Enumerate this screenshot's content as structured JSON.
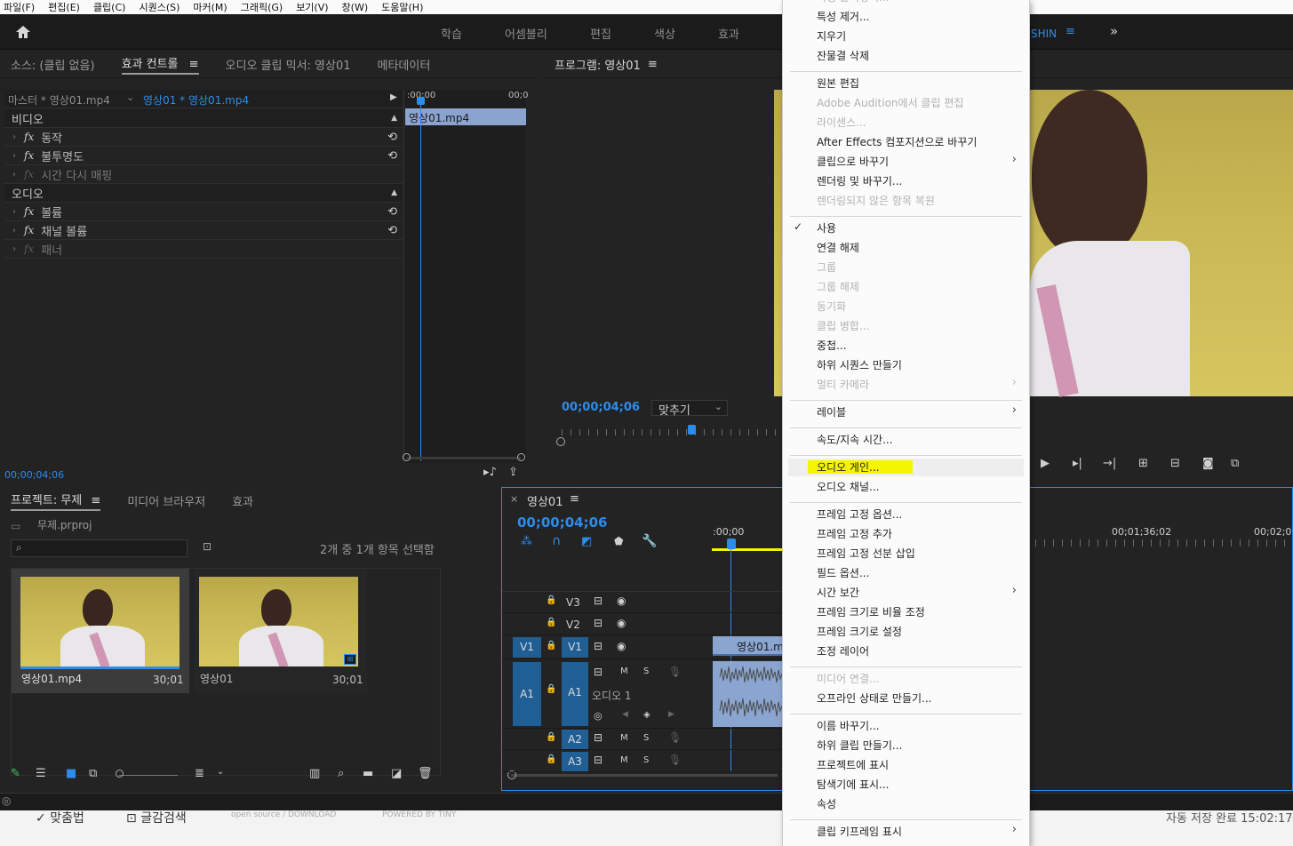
{
  "menubar": [
    "파일(F)",
    "편집(E)",
    "클립(C)",
    "시퀀스(S)",
    "마커(M)",
    "그래픽(G)",
    "보기(V)",
    "창(W)",
    "도움말(H)"
  ],
  "workspaces": [
    "학습",
    "어셈블리",
    "편집",
    "색상",
    "효과"
  ],
  "user_fragment": "SHIN",
  "icons": {
    "home": "home-icon",
    "more": "double-chevron-right-icon"
  },
  "source_panel": {
    "tabs": [
      "소스: (클립 없음)",
      "효과 컨트롤",
      "오디오 클립 믹서: 영상01",
      "메타데이터"
    ],
    "active_tab": "효과 컨트롤",
    "master_label": "마스터 * 영상01.mp4",
    "sequence_label": "영상01 * 영상01.mp4",
    "ruler_start": ":00;00",
    "ruler_end": "00;0",
    "clip_name": "영상01.mp4",
    "sections": [
      {
        "title": "비디오",
        "effects": [
          {
            "name": "동작",
            "enabled": true
          },
          {
            "name": "불투명도",
            "enabled": true
          },
          {
            "name": "시간 다시 매핑",
            "enabled": false
          }
        ]
      },
      {
        "title": "오디오",
        "effects": [
          {
            "name": "볼륨",
            "enabled": true
          },
          {
            "name": "채널 볼륨",
            "enabled": true
          },
          {
            "name": "패너",
            "enabled": false
          }
        ]
      }
    ],
    "timecode": "00;00;04;06"
  },
  "program_monitor": {
    "title": "프로그램: 영상01",
    "timecode": "00;00;04;06",
    "fit": "맞추기"
  },
  "project_panel": {
    "tabs": [
      "프로젝트: 무제",
      "미디어 브라우저",
      "효과"
    ],
    "project_file": "무제.prproj",
    "search_placeholder": "",
    "selection_status": "2개 중 1개 항목 선택함",
    "items": [
      {
        "name": "영상01.mp4",
        "duration": "30;01",
        "selected": true
      },
      {
        "name": "영상01",
        "duration": "30;01",
        "selected": false
      }
    ]
  },
  "timeline": {
    "title": "영상01",
    "timecode": "00;00;04;06",
    "ruler": [
      ":00;00",
      "00;01;36;02",
      "00;02;0"
    ],
    "tracks": {
      "video": [
        {
          "name": "V3"
        },
        {
          "name": "V2"
        },
        {
          "name": "V1",
          "source": "V1",
          "clip": "영상01.m"
        }
      ],
      "audio": [
        {
          "name": "A1",
          "source": "A1",
          "label": "오디오 1"
        },
        {
          "name": "A2"
        },
        {
          "name": "A3"
        }
      ]
    },
    "track_buttons": {
      "mute": "M",
      "solo": "S"
    }
  },
  "context_menu": {
    "items": [
      {
        "label": "속성 붙여넣기...",
        "disabled": true,
        "partial": true
      },
      {
        "label": "특성 제거...",
        "disabled": false
      },
      {
        "label": "지우기",
        "disabled": false
      },
      {
        "label": "잔물결 삭제",
        "disabled": false
      },
      {
        "sep": true
      },
      {
        "label": "원본 편집",
        "disabled": false
      },
      {
        "label": "Adobe Audition에서 클립 편집",
        "disabled": true
      },
      {
        "label": "라이센스...",
        "disabled": true
      },
      {
        "label": "After Effects 컴포지션으로 바꾸기",
        "disabled": false
      },
      {
        "label": "클립으로 바꾸기",
        "disabled": false,
        "submenu": true
      },
      {
        "label": "렌더링 및 바꾸기...",
        "disabled": false
      },
      {
        "label": "렌더링되지 않은 항목 복원",
        "disabled": true
      },
      {
        "sep": true
      },
      {
        "label": "사용",
        "disabled": false,
        "checked": true
      },
      {
        "label": "연결 해제",
        "disabled": false
      },
      {
        "label": "그룹",
        "disabled": true
      },
      {
        "label": "그룹 해제",
        "disabled": true
      },
      {
        "label": "동기화",
        "disabled": true
      },
      {
        "label": "클립 병합...",
        "disabled": true
      },
      {
        "label": "중첩...",
        "disabled": false
      },
      {
        "label": "하위 시퀀스 만들기",
        "disabled": false
      },
      {
        "label": "멀티 카메라",
        "disabled": true,
        "submenu": true
      },
      {
        "sep": true
      },
      {
        "label": "레이블",
        "disabled": false,
        "submenu": true
      },
      {
        "sep": true
      },
      {
        "label": "속도/지속 시간...",
        "disabled": false
      },
      {
        "sep": true
      },
      {
        "label": "오디오 게인...",
        "disabled": false,
        "highlighted": true
      },
      {
        "label": "오디오 채널...",
        "disabled": false
      },
      {
        "sep": true
      },
      {
        "label": "프레임 고정 옵션...",
        "disabled": false
      },
      {
        "label": "프레임 고정 추가",
        "disabled": false
      },
      {
        "label": "프레임 고정 선분 삽입",
        "disabled": false
      },
      {
        "label": "필드 옵션...",
        "disabled": false
      },
      {
        "label": "시간 보간",
        "disabled": false,
        "submenu": true
      },
      {
        "label": "프레임 크기로 비율 조정",
        "disabled": false
      },
      {
        "label": "프레임 크기로 설정",
        "disabled": false
      },
      {
        "label": "조정 레이어",
        "disabled": false
      },
      {
        "sep": true
      },
      {
        "label": "미디어 연결...",
        "disabled": true
      },
      {
        "label": "오프라인 상태로 만들기...",
        "disabled": false
      },
      {
        "sep": true
      },
      {
        "label": "이름 바꾸기...",
        "disabled": false
      },
      {
        "label": "하위 클립 만들기...",
        "disabled": false
      },
      {
        "label": "프로젝트에 표시",
        "disabled": false
      },
      {
        "label": "탐색기에 표시...",
        "disabled": false
      },
      {
        "label": "속성",
        "disabled": false
      },
      {
        "sep": true
      },
      {
        "label": "클립 키프레임 표시",
        "disabled": false,
        "submenu": true
      }
    ]
  },
  "underlay": {
    "left": [
      "맞춤법",
      "글감검색",
      "open source / DOWNLOAD",
      "POWERED BY TINY"
    ],
    "right": "자동 저장 완료 15:02:17"
  },
  "colors": {
    "accent": "#2d8ceb",
    "highlight": "#f5f500",
    "track_blue": "#1f5f95",
    "clip_blue": "#7a9fd4",
    "audio_clip": "#8aa5d0"
  }
}
